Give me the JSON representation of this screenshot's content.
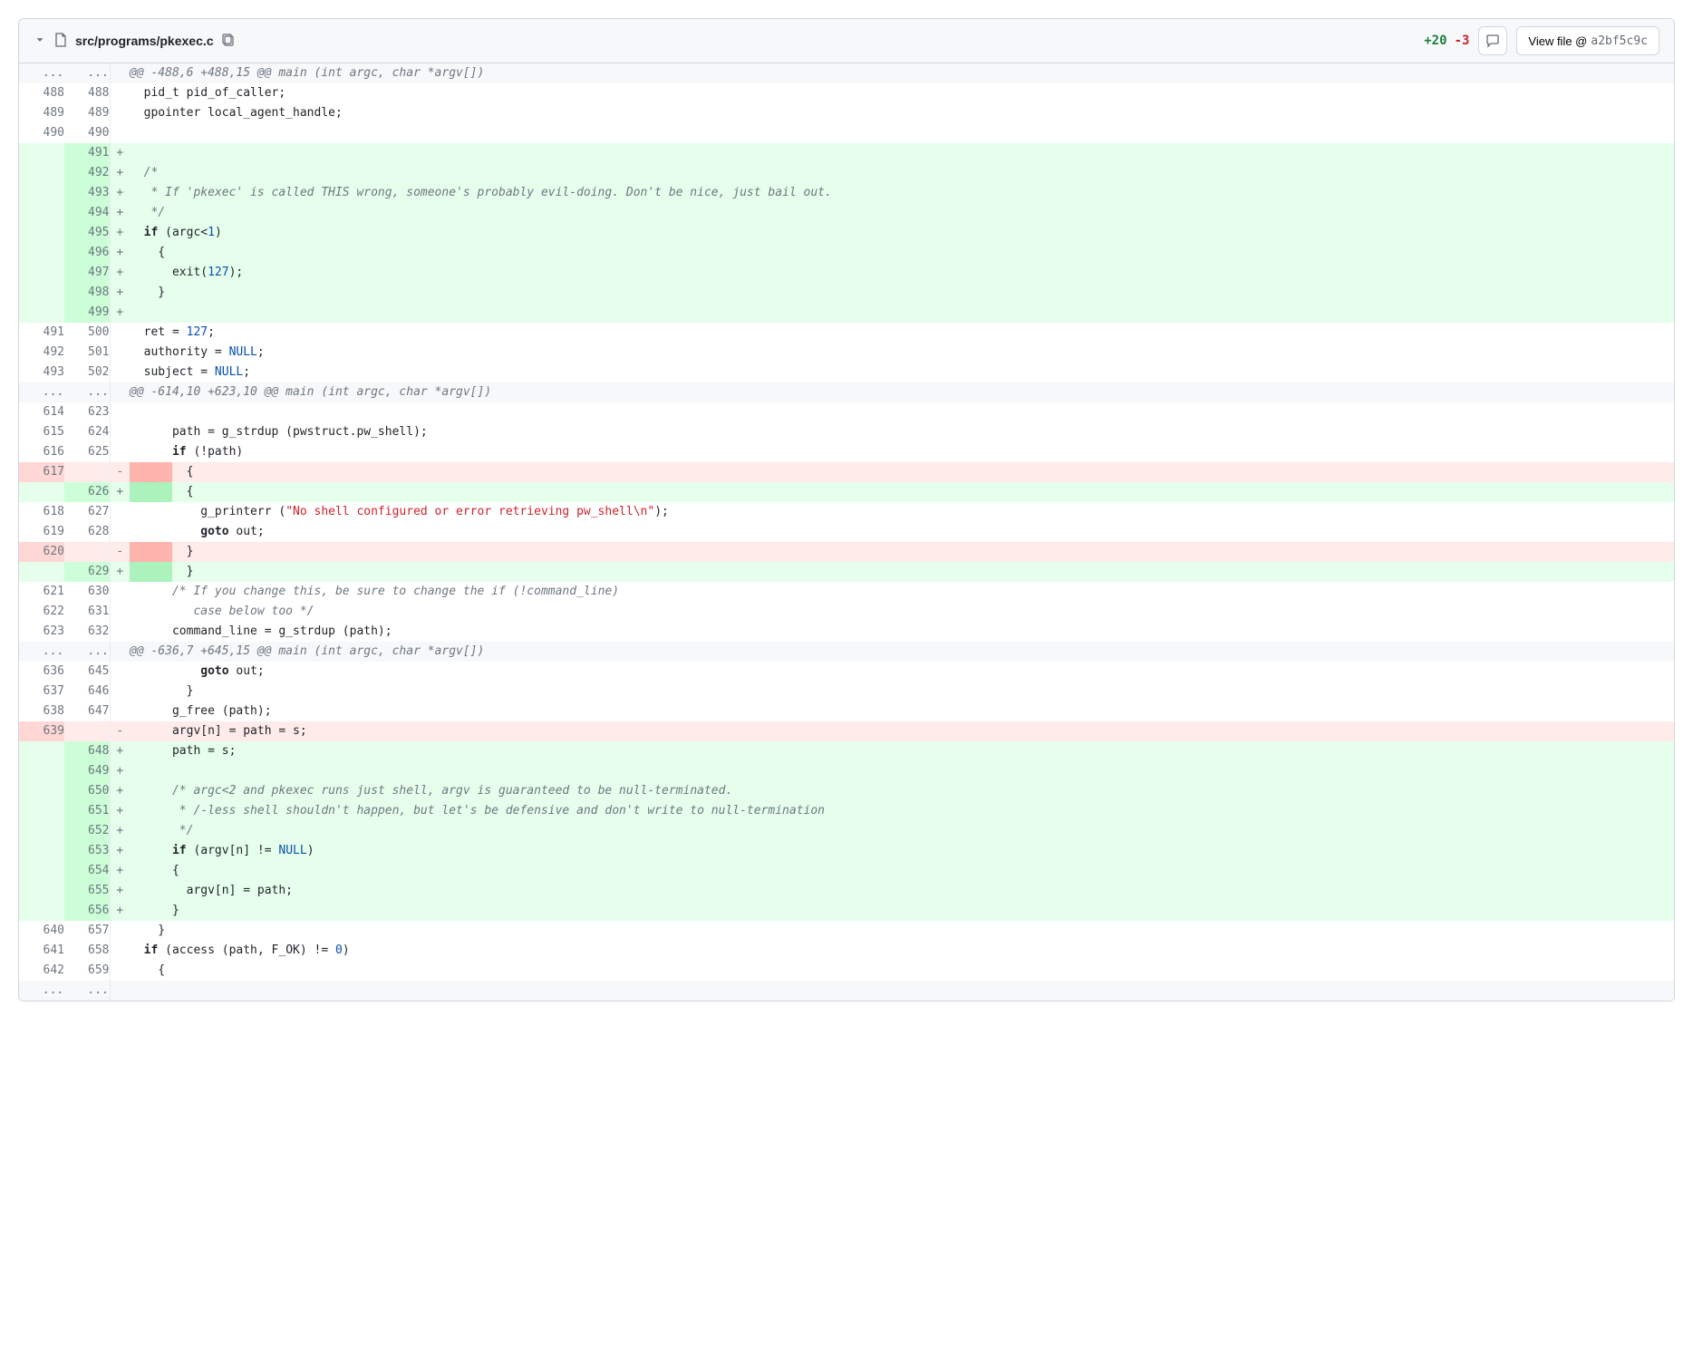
{
  "header": {
    "file_path": "src/programs/pkexec.c",
    "additions": "+20",
    "deletions": "-3",
    "view_file_label": "View file @ ",
    "sha": "a2bf5c9c"
  },
  "rows": [
    {
      "type": "hunk",
      "old": "...",
      "new": "...",
      "sign": "",
      "tokens": [
        {
          "t": "@@ -488,6 +488,15 @@ main (int argc, char *argv[])",
          "c": "cm"
        }
      ]
    },
    {
      "type": "ctx",
      "old": "488",
      "new": "488",
      "sign": "",
      "tokens": [
        {
          "t": "  pid_t pid_of_caller;"
        }
      ]
    },
    {
      "type": "ctx",
      "old": "489",
      "new": "489",
      "sign": "",
      "tokens": [
        {
          "t": "  gpointer local_agent_handle;"
        }
      ]
    },
    {
      "type": "ctx",
      "old": "490",
      "new": "490",
      "sign": "",
      "tokens": [
        {
          "t": ""
        }
      ]
    },
    {
      "type": "add",
      "old": "",
      "new": "491",
      "sign": "+",
      "tokens": [
        {
          "t": ""
        }
      ]
    },
    {
      "type": "add",
      "old": "",
      "new": "492",
      "sign": "+",
      "tokens": [
        {
          "t": "  "
        },
        {
          "t": "/*",
          "c": "cm"
        }
      ]
    },
    {
      "type": "add",
      "old": "",
      "new": "493",
      "sign": "+",
      "tokens": [
        {
          "t": "   * If 'pkexec' is called THIS wrong, someone's probably evil-doing. Don't be nice, just bail out.",
          "c": "cm"
        }
      ]
    },
    {
      "type": "add",
      "old": "",
      "new": "494",
      "sign": "+",
      "tokens": [
        {
          "t": "   */",
          "c": "cm"
        }
      ]
    },
    {
      "type": "add",
      "old": "",
      "new": "495",
      "sign": "+",
      "tokens": [
        {
          "t": "  "
        },
        {
          "t": "if",
          "c": "kw"
        },
        {
          "t": " (argc<"
        },
        {
          "t": "1",
          "c": "num"
        },
        {
          "t": ")"
        }
      ]
    },
    {
      "type": "add",
      "old": "",
      "new": "496",
      "sign": "+",
      "tokens": [
        {
          "t": "    {"
        }
      ]
    },
    {
      "type": "add",
      "old": "",
      "new": "497",
      "sign": "+",
      "tokens": [
        {
          "t": "      exit("
        },
        {
          "t": "127",
          "c": "num"
        },
        {
          "t": ");"
        }
      ]
    },
    {
      "type": "add",
      "old": "",
      "new": "498",
      "sign": "+",
      "tokens": [
        {
          "t": "    }"
        }
      ]
    },
    {
      "type": "add",
      "old": "",
      "new": "499",
      "sign": "+",
      "tokens": [
        {
          "t": ""
        }
      ]
    },
    {
      "type": "ctx",
      "old": "491",
      "new": "500",
      "sign": "",
      "tokens": [
        {
          "t": "  ret = "
        },
        {
          "t": "127",
          "c": "num"
        },
        {
          "t": ";"
        }
      ]
    },
    {
      "type": "ctx",
      "old": "492",
      "new": "501",
      "sign": "",
      "tokens": [
        {
          "t": "  authority = "
        },
        {
          "t": "NULL",
          "c": "null"
        },
        {
          "t": ";"
        }
      ]
    },
    {
      "type": "ctx",
      "old": "493",
      "new": "502",
      "sign": "",
      "tokens": [
        {
          "t": "  subject = "
        },
        {
          "t": "NULL",
          "c": "null"
        },
        {
          "t": ";"
        }
      ]
    },
    {
      "type": "hunk",
      "old": "...",
      "new": "...",
      "sign": "",
      "tokens": [
        {
          "t": "@@ -614,10 +623,10 @@ main (int argc, char *argv[])",
          "c": "cm"
        }
      ]
    },
    {
      "type": "ctx",
      "old": "614",
      "new": "623",
      "sign": "",
      "tokens": [
        {
          "t": ""
        }
      ]
    },
    {
      "type": "ctx",
      "old": "615",
      "new": "624",
      "sign": "",
      "tokens": [
        {
          "t": "      path = g_strdup (pwstruct.pw_shell);"
        }
      ]
    },
    {
      "type": "ctx",
      "old": "616",
      "new": "625",
      "sign": "",
      "tokens": [
        {
          "t": "      "
        },
        {
          "t": "if",
          "c": "kw"
        },
        {
          "t": " (!path)"
        }
      ]
    },
    {
      "type": "del",
      "old": "617",
      "new": "",
      "sign": "-",
      "tokens": [
        {
          "t": "      ",
          "c": "hl-del"
        },
        {
          "t": "  {"
        }
      ]
    },
    {
      "type": "add",
      "old": "",
      "new": "626",
      "sign": "+",
      "tokens": [
        {
          "t": "      ",
          "c": "hl-add"
        },
        {
          "t": "  {"
        }
      ]
    },
    {
      "type": "ctx",
      "old": "618",
      "new": "627",
      "sign": "",
      "tokens": [
        {
          "t": "          g_printerr ("
        },
        {
          "t": "\"No shell configured or error retrieving pw_shell\\n\"",
          "c": "str"
        },
        {
          "t": ");"
        }
      ]
    },
    {
      "type": "ctx",
      "old": "619",
      "new": "628",
      "sign": "",
      "tokens": [
        {
          "t": "          "
        },
        {
          "t": "goto",
          "c": "kw"
        },
        {
          "t": " out;"
        }
      ]
    },
    {
      "type": "del",
      "old": "620",
      "new": "",
      "sign": "-",
      "tokens": [
        {
          "t": "      ",
          "c": "hl-del"
        },
        {
          "t": "  }"
        }
      ]
    },
    {
      "type": "add",
      "old": "",
      "new": "629",
      "sign": "+",
      "tokens": [
        {
          "t": "      ",
          "c": "hl-add"
        },
        {
          "t": "  }"
        }
      ]
    },
    {
      "type": "ctx",
      "old": "621",
      "new": "630",
      "sign": "",
      "tokens": [
        {
          "t": "      "
        },
        {
          "t": "/* If you change this, be sure to change the if (!command_line)",
          "c": "cm"
        }
      ]
    },
    {
      "type": "ctx",
      "old": "622",
      "new": "631",
      "sign": "",
      "tokens": [
        {
          "t": "         case below too */",
          "c": "cm"
        }
      ]
    },
    {
      "type": "ctx",
      "old": "623",
      "new": "632",
      "sign": "",
      "tokens": [
        {
          "t": "      command_line = g_strdup (path);"
        }
      ]
    },
    {
      "type": "hunk",
      "old": "...",
      "new": "...",
      "sign": "",
      "tokens": [
        {
          "t": "@@ -636,7 +645,15 @@ main (int argc, char *argv[])",
          "c": "cm"
        }
      ]
    },
    {
      "type": "ctx",
      "old": "636",
      "new": "645",
      "sign": "",
      "tokens": [
        {
          "t": "          "
        },
        {
          "t": "goto",
          "c": "kw"
        },
        {
          "t": " out;"
        }
      ]
    },
    {
      "type": "ctx",
      "old": "637",
      "new": "646",
      "sign": "",
      "tokens": [
        {
          "t": "        }"
        }
      ]
    },
    {
      "type": "ctx",
      "old": "638",
      "new": "647",
      "sign": "",
      "tokens": [
        {
          "t": "      g_free (path);"
        }
      ]
    },
    {
      "type": "del",
      "old": "639",
      "new": "",
      "sign": "-",
      "tokens": [
        {
          "t": "      argv[n] = path = s;"
        }
      ]
    },
    {
      "type": "add",
      "old": "",
      "new": "648",
      "sign": "+",
      "tokens": [
        {
          "t": "      path = s;"
        }
      ]
    },
    {
      "type": "add",
      "old": "",
      "new": "649",
      "sign": "+",
      "tokens": [
        {
          "t": ""
        }
      ]
    },
    {
      "type": "add",
      "old": "",
      "new": "650",
      "sign": "+",
      "tokens": [
        {
          "t": "      "
        },
        {
          "t": "/* argc<2 and pkexec runs just shell, argv is guaranteed to be null-terminated.",
          "c": "cm"
        }
      ]
    },
    {
      "type": "add",
      "old": "",
      "new": "651",
      "sign": "+",
      "tokens": [
        {
          "t": "       * /-less shell shouldn't happen, but let's be defensive and don't write to null-termination",
          "c": "cm"
        }
      ]
    },
    {
      "type": "add",
      "old": "",
      "new": "652",
      "sign": "+",
      "tokens": [
        {
          "t": "       */",
          "c": "cm"
        }
      ]
    },
    {
      "type": "add",
      "old": "",
      "new": "653",
      "sign": "+",
      "tokens": [
        {
          "t": "      "
        },
        {
          "t": "if",
          "c": "kw"
        },
        {
          "t": " (argv[n] != "
        },
        {
          "t": "NULL",
          "c": "null"
        },
        {
          "t": ")"
        }
      ]
    },
    {
      "type": "add",
      "old": "",
      "new": "654",
      "sign": "+",
      "tokens": [
        {
          "t": "      {"
        }
      ]
    },
    {
      "type": "add",
      "old": "",
      "new": "655",
      "sign": "+",
      "tokens": [
        {
          "t": "        argv[n] = path;"
        }
      ]
    },
    {
      "type": "add",
      "old": "",
      "new": "656",
      "sign": "+",
      "tokens": [
        {
          "t": "      }"
        }
      ]
    },
    {
      "type": "ctx",
      "old": "640",
      "new": "657",
      "sign": "",
      "tokens": [
        {
          "t": "    }"
        }
      ]
    },
    {
      "type": "ctx",
      "old": "641",
      "new": "658",
      "sign": "",
      "tokens": [
        {
          "t": "  "
        },
        {
          "t": "if",
          "c": "kw"
        },
        {
          "t": " (access (path, F_OK) != "
        },
        {
          "t": "0",
          "c": "num"
        },
        {
          "t": ")"
        }
      ]
    },
    {
      "type": "ctx",
      "old": "642",
      "new": "659",
      "sign": "",
      "tokens": [
        {
          "t": "    {"
        }
      ]
    },
    {
      "type": "hunk",
      "old": "...",
      "new": "...",
      "sign": "",
      "tokens": [
        {
          "t": ""
        }
      ]
    }
  ]
}
